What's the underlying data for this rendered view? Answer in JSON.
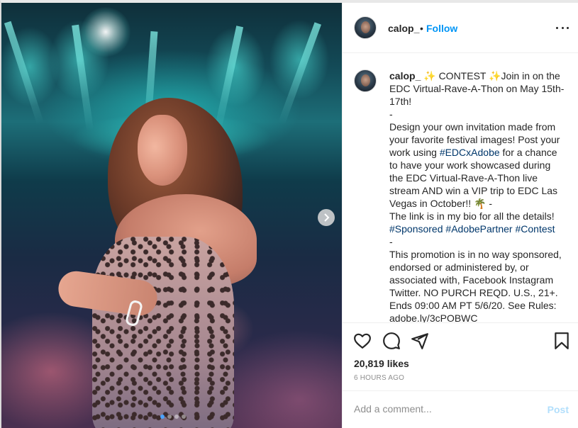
{
  "post": {
    "username": "calop_",
    "separator": "•",
    "follow_label": "Follow",
    "more_icon": "more-options-icon"
  },
  "caption": {
    "username": "calop_",
    "lines": [
      "✨ CONTEST ✨Join in on the EDC Virtual-Rave-A-Thon on May 15th-17th!",
      "-",
      "Design your own invitation made from your favorite festival images! Post your work using ",
      "#EDCxAdobe",
      " for a chance to have your work showcased during the EDC Virtual-Rave-A-Thon live stream AND win a VIP trip to EDC Las Vegas in October!! 🌴 -",
      "The link is in my bio for all the details!",
      "#Sponsored",
      "#AdobePartner",
      "#Contest",
      "-",
      "This promotion is in no way sponsored, endorsed or administered by, or associated with, Facebook Instagram Twitter. NO PURCH REQD. U.S., 21+. Ends 09:00 AM PT 5/6/20. See Rules: adobe.ly/3cPOBWC"
    ]
  },
  "engagement": {
    "likes_label": "20,819 likes",
    "time_label": "6 HOURS AGO"
  },
  "comment": {
    "placeholder": "Add a comment...",
    "post_label": "Post"
  },
  "carousel": {
    "slide_count": 4,
    "active_index": 0
  },
  "colors": {
    "accent": "#0095f6",
    "hashtag": "#00376b",
    "post_disabled": "#b2dffc",
    "muted": "#8e8e8e"
  }
}
